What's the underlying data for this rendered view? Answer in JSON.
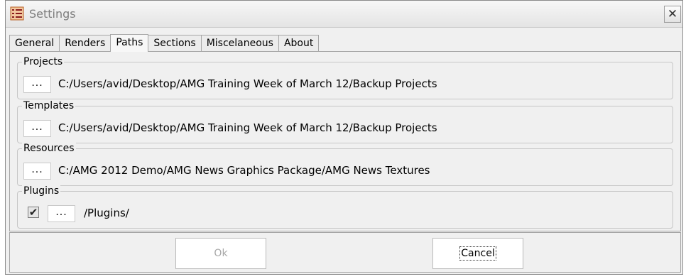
{
  "window": {
    "title": "Settings"
  },
  "tabs": [
    {
      "label": "General"
    },
    {
      "label": "Renders"
    },
    {
      "label": "Paths",
      "active": true
    },
    {
      "label": "Sections"
    },
    {
      "label": "Miscelaneous"
    },
    {
      "label": "About"
    }
  ],
  "paths": {
    "projects": {
      "legend": "Projects",
      "browse_label": "...",
      "path": "C:/Users/avid/Desktop/AMG Training Week of March 12/Backup Projects"
    },
    "templates": {
      "legend": "Templates",
      "browse_label": "...",
      "path": "C:/Users/avid/Desktop/AMG Training Week of March 12/Backup Projects"
    },
    "resources": {
      "legend": "Resources",
      "browse_label": "...",
      "path": "C:/AMG 2012 Demo/AMG News Graphics Package/AMG News Textures"
    },
    "plugins": {
      "legend": "Plugins",
      "enabled": true,
      "browse_label": "...",
      "path": "/Plugins/"
    }
  },
  "buttons": {
    "ok_label": "Ok",
    "cancel_label": "Cancel"
  },
  "icons": {
    "app": "settings-list-icon",
    "close": "close-icon",
    "check": "checkmark-icon"
  }
}
